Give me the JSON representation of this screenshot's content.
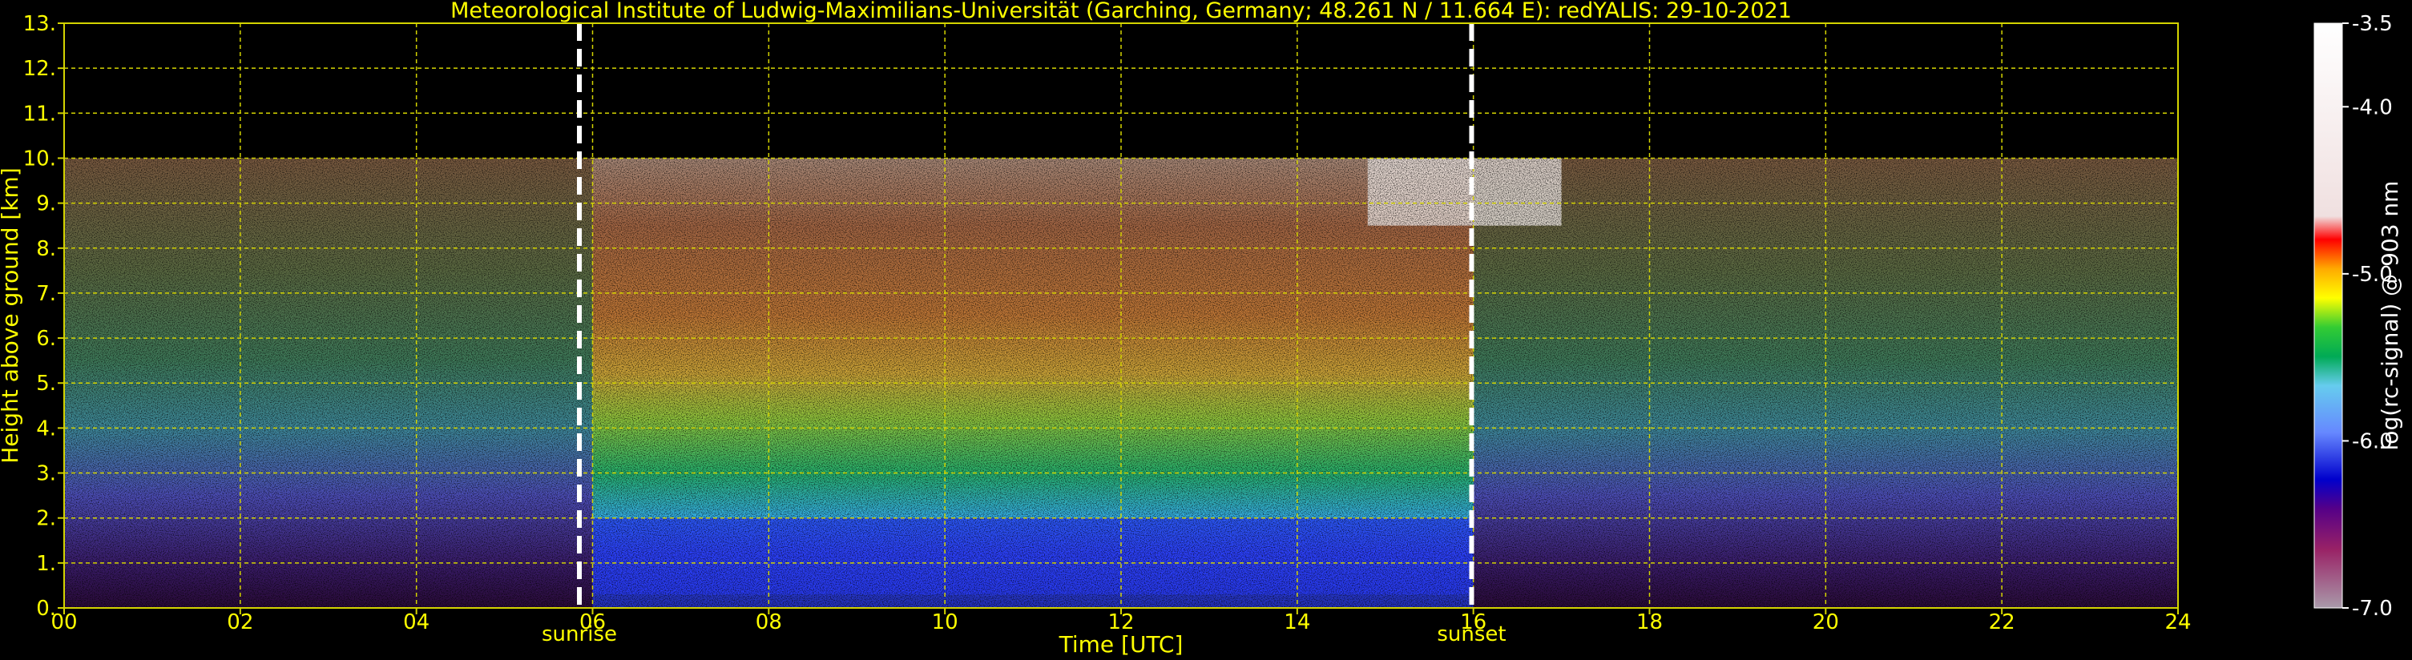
{
  "chart_data": {
    "type": "heatmap",
    "title": "Meteorological Institute of Ludwig-Maximilians-Universität (Garching, Germany; 48.261 N / 11.664 E):    redYALIS: 29-10-2021",
    "xlabel": "Time [UTC]",
    "ylabel": "Height above ground [km]",
    "xlim": [
      0,
      24
    ],
    "ylim": [
      0,
      13
    ],
    "x_ticks": [
      "00",
      "02",
      "04",
      "06",
      "08",
      "10",
      "12",
      "14",
      "16",
      "18",
      "20",
      "22",
      "24"
    ],
    "y_ticks": [
      "0.",
      "1.",
      "2.",
      "3.",
      "4.",
      "5.",
      "6.",
      "7.",
      "8.",
      "9.",
      "10.",
      "11.",
      "12.",
      "13."
    ],
    "grid": true,
    "data_top_km": 10,
    "annotations": [
      {
        "label": "sunrise",
        "x": 5.85
      },
      {
        "label": "sunset",
        "x": 15.98
      }
    ],
    "colorbar": {
      "label": "log(rc-signal) @ 903 nm",
      "range": [
        -7.0,
        -3.5
      ],
      "ticks": [
        "-3.5",
        "-4.0",
        "-5.0",
        "-6.0",
        "-7.0"
      ]
    },
    "features": [
      {
        "name": "boundary layer aerosol (blue)",
        "x_start": 6.0,
        "x_end": 16.0,
        "height_km": [
          0.3,
          2.0
        ]
      },
      {
        "name": "cirrus cloud",
        "x_start": 14.8,
        "x_end": 17.0,
        "height_km": [
          8.5,
          10.0
        ]
      }
    ]
  },
  "colors": {
    "text": "#ffff00",
    "grid": "#d4d400",
    "background": "#000000",
    "marker_line": "#ffffff"
  }
}
